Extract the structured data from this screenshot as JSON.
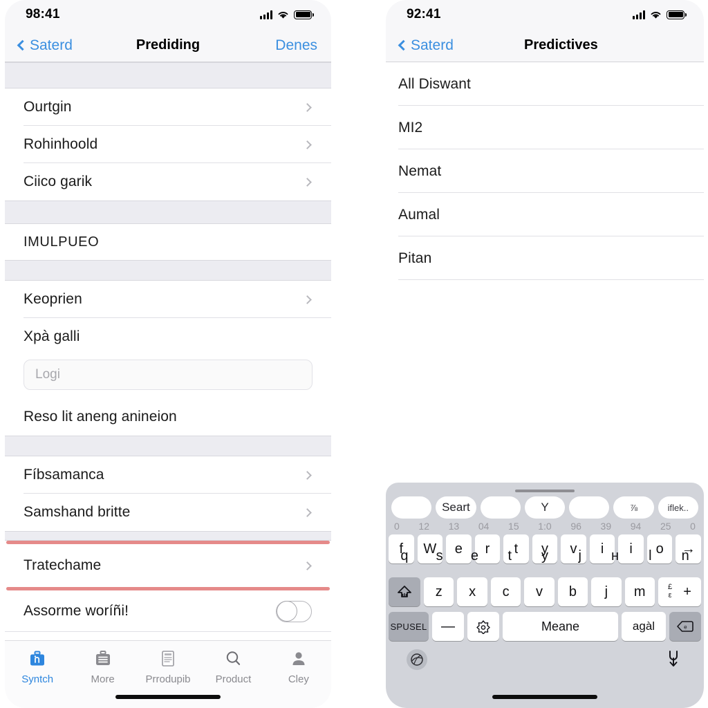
{
  "left_phone": {
    "status": {
      "time": "98:41",
      "signal_icon": "cellular-bars-icon",
      "wifi_icon": "wifi-icon",
      "battery_icon": "battery-full-icon"
    },
    "nav": {
      "back_label": "Saterd",
      "title": "Prediding",
      "right_action": "Denes"
    },
    "sections": [
      {
        "type": "gap",
        "height": "tall"
      },
      {
        "type": "rows",
        "rows": [
          {
            "label": "Ourtgin",
            "chevron": true
          },
          {
            "label": "Rohinhoold",
            "chevron": true
          },
          {
            "label": "Ciico garik",
            "chevron": true
          }
        ]
      },
      {
        "type": "gap",
        "height": "mid"
      },
      {
        "type": "rows",
        "rows": [
          {
            "label": "IMULPUEO",
            "chevron": false
          }
        ]
      },
      {
        "type": "gap",
        "height": "short"
      },
      {
        "type": "rows",
        "rows": [
          {
            "label": "Keoprien",
            "chevron": true
          }
        ]
      },
      {
        "type": "field_group",
        "title": "Xpà galli",
        "field_placeholder": "Logi",
        "field_value": "",
        "caption": "Reso lit aneng anineion"
      },
      {
        "type": "gap",
        "height": "short"
      },
      {
        "type": "rows",
        "rows": [
          {
            "label": "Fíbsamanca",
            "chevron": true
          },
          {
            "label": "Samshand britte",
            "chevron": true
          }
        ]
      },
      {
        "type": "redline"
      },
      {
        "type": "rows",
        "rows": [
          {
            "label": "Tratechame",
            "chevron": true
          }
        ]
      },
      {
        "type": "redline"
      },
      {
        "type": "toggle_row",
        "label": "Assorme woríñi!",
        "on": false
      }
    ],
    "tabbar": [
      {
        "label": "Syntch",
        "icon": "briefcase-icon",
        "active": true
      },
      {
        "label": "More",
        "icon": "drawer-icon",
        "active": false
      },
      {
        "label": "Prrodupib",
        "icon": "document-icon",
        "active": false
      },
      {
        "label": "Product",
        "icon": "search-icon",
        "active": false
      },
      {
        "label": "Cley",
        "icon": "person-icon",
        "active": false
      }
    ]
  },
  "right_phone": {
    "status": {
      "time": "92:41",
      "signal_icon": "cellular-bars-icon",
      "wifi_icon": "wifi-icon",
      "battery_icon": "battery-full-icon"
    },
    "nav": {
      "back_label": "Saterd",
      "title": "Predictives"
    },
    "list": [
      {
        "label": "All Diswant"
      },
      {
        "label": "MI2"
      },
      {
        "label": "Nemat"
      },
      {
        "label": "Aumal"
      },
      {
        "label": "Pitan"
      }
    ],
    "keyboard": {
      "suggestions": [
        "",
        "Seart",
        "",
        "Y",
        "",
        "⅞",
        "iflek.."
      ],
      "number_row": [
        "0",
        "12",
        "13",
        "04",
        "15",
        "1:0",
        "96",
        "39",
        "94",
        "25",
        "0"
      ],
      "row1": [
        "f",
        "W",
        "e",
        "r",
        "t",
        "y",
        "v",
        "i",
        "i",
        "o",
        "→"
      ],
      "row_overlay": [
        "q",
        "s",
        "e",
        "t",
        "y",
        "j",
        "н",
        "l",
        "n"
      ],
      "row2_shift": "shift-icon",
      "row2": [
        "z",
        "x",
        "c",
        "v",
        "b",
        "j",
        "m"
      ],
      "row2_extra": {
        "mini_top": "£",
        "mini_bottom": "ε",
        "plus": "+"
      },
      "row3": {
        "left_key": "SPUSEL",
        "dash_key": "—",
        "emoji_key": "emoji-icon",
        "space_key": "Meane",
        "return_key": "agàl",
        "delete_key": "delete-icon"
      },
      "bottom": {
        "globe": "globe-icon",
        "mic": "mic-icon"
      }
    }
  },
  "colors": {
    "accent_blue": "#3b8fe0",
    "tab_active": "#2e86de",
    "red_divider": "#e58a89",
    "section_gap": "#ececf1",
    "keyboard_bg": "#d2d4da"
  }
}
